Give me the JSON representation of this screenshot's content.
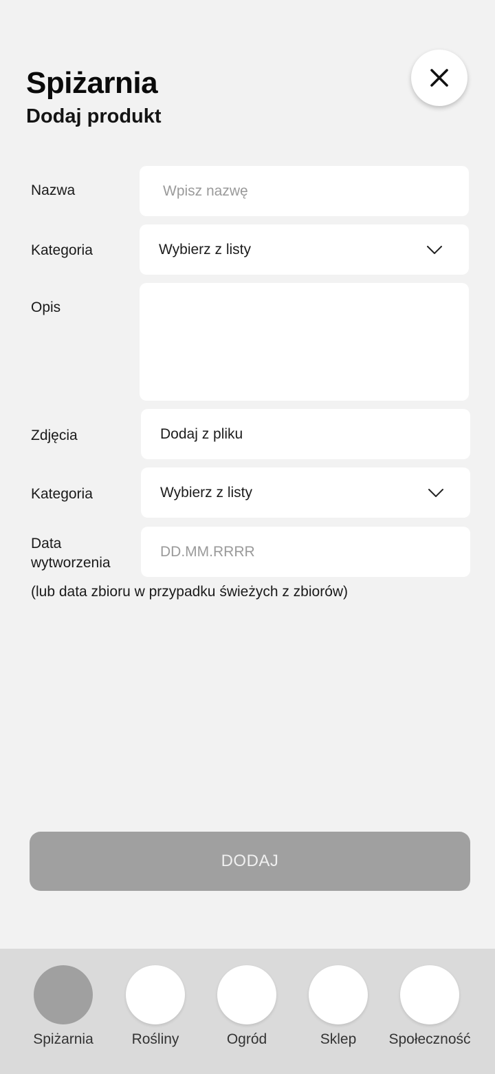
{
  "header": {
    "title": "Spiżarnia",
    "subtitle": "Dodaj produkt"
  },
  "close_icon": "close-icon",
  "form": {
    "name": {
      "label": "Nazwa",
      "placeholder": "Wpisz nazwę"
    },
    "category1": {
      "label": "Kategoria",
      "value": "Wybierz z listy"
    },
    "description": {
      "label": "Opis",
      "value": ""
    },
    "photos": {
      "label": "Zdjęcia",
      "value": "Dodaj z pliku"
    },
    "category2": {
      "label": "Kategoria",
      "value": "Wybierz z listy"
    },
    "date": {
      "label_line1": "Data",
      "label_line2": "wytworzenia",
      "placeholder": "DD.MM.RRRR"
    },
    "hint": "(lub data zbioru w przypadku świeżych z zbiorów)"
  },
  "submit_label": "DODAJ",
  "nav": {
    "items": [
      {
        "label": "Spiżarnia",
        "active": true
      },
      {
        "label": "Rośliny",
        "active": false
      },
      {
        "label": "Ogród",
        "active": false
      },
      {
        "label": "Sklep",
        "active": false
      },
      {
        "label": "Społeczność",
        "active": false
      }
    ]
  },
  "colors": {
    "background": "#f2f2f2",
    "field": "#ffffff",
    "button": "#a0a0a0",
    "nav_bar": "#dadada",
    "nav_active": "#a0a0a0"
  }
}
